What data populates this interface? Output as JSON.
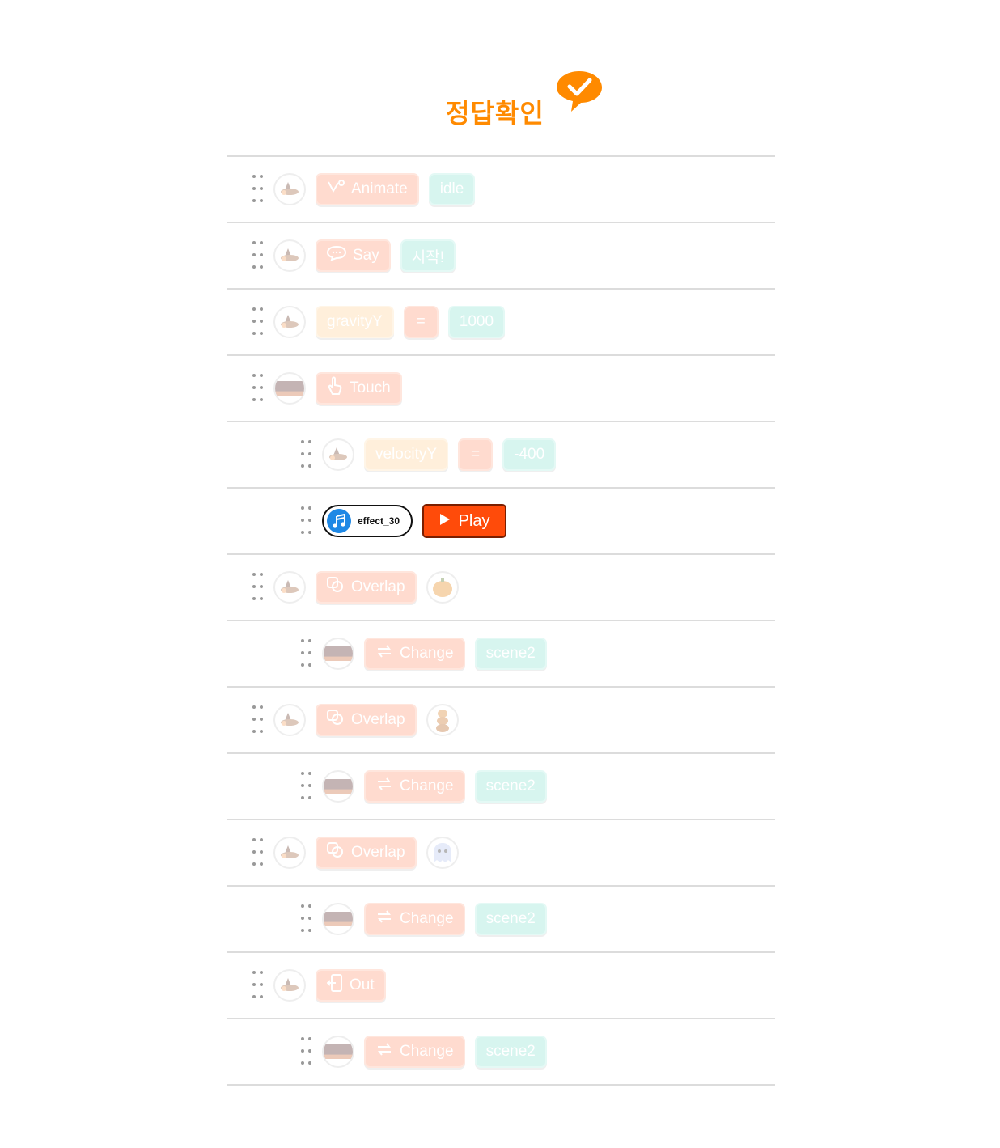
{
  "header": {
    "title": "정답확인",
    "check_icon": "check-bubble-icon",
    "accent": "#ff8a00"
  },
  "rows": [
    {
      "indent": 0,
      "avatar": "witch-sprite",
      "blocks": [
        {
          "kind": "action",
          "icon": "animate-icon",
          "label": "Animate"
        },
        {
          "kind": "value",
          "label": "idle"
        }
      ]
    },
    {
      "indent": 0,
      "avatar": "witch-sprite",
      "blocks": [
        {
          "kind": "action",
          "icon": "speech-bubble-icon",
          "label": "Say"
        },
        {
          "kind": "value",
          "label": "시작!"
        }
      ]
    },
    {
      "indent": 0,
      "avatar": "witch-sprite",
      "blocks": [
        {
          "kind": "property",
          "label": "gravityY"
        },
        {
          "kind": "operator",
          "label": "="
        },
        {
          "kind": "value",
          "label": "1000"
        }
      ]
    },
    {
      "indent": 0,
      "avatar": "background-sprite",
      "blocks": [
        {
          "kind": "action",
          "icon": "touch-icon",
          "label": "Touch"
        }
      ]
    },
    {
      "indent": 1,
      "avatar": "witch-sprite",
      "blocks": [
        {
          "kind": "property",
          "label": "velocityY"
        },
        {
          "kind": "operator",
          "label": "="
        },
        {
          "kind": "value",
          "label": "-400"
        }
      ]
    },
    {
      "indent": 1,
      "active": true,
      "sound": {
        "name": "effect_30",
        "icon": "music-note-icon"
      },
      "play": {
        "label": "Play",
        "icon": "play-icon",
        "color": "#ff4b0a"
      }
    },
    {
      "indent": 0,
      "avatar": "witch-sprite",
      "blocks": [
        {
          "kind": "action",
          "icon": "overlap-icon",
          "label": "Overlap"
        },
        {
          "kind": "target",
          "target": "pumpkin-sprite"
        }
      ]
    },
    {
      "indent": 1,
      "avatar": "background-sprite",
      "blocks": [
        {
          "kind": "action",
          "icon": "change-icon",
          "label": "Change"
        },
        {
          "kind": "value",
          "label": "scene2"
        }
      ]
    },
    {
      "indent": 0,
      "avatar": "witch-sprite",
      "blocks": [
        {
          "kind": "action",
          "icon": "overlap-icon",
          "label": "Overlap"
        },
        {
          "kind": "target",
          "target": "pumpkin-stack-sprite"
        }
      ]
    },
    {
      "indent": 1,
      "avatar": "background-sprite",
      "blocks": [
        {
          "kind": "action",
          "icon": "change-icon",
          "label": "Change"
        },
        {
          "kind": "value",
          "label": "scene2"
        }
      ]
    },
    {
      "indent": 0,
      "avatar": "witch-sprite",
      "blocks": [
        {
          "kind": "action",
          "icon": "overlap-icon",
          "label": "Overlap"
        },
        {
          "kind": "target",
          "target": "ghost-sprite"
        }
      ]
    },
    {
      "indent": 1,
      "avatar": "background-sprite",
      "blocks": [
        {
          "kind": "action",
          "icon": "change-icon",
          "label": "Change"
        },
        {
          "kind": "value",
          "label": "scene2"
        }
      ]
    },
    {
      "indent": 0,
      "avatar": "witch-sprite",
      "blocks": [
        {
          "kind": "action",
          "icon": "exit-icon",
          "label": "Out"
        }
      ]
    },
    {
      "indent": 1,
      "avatar": "background-sprite",
      "blocks": [
        {
          "kind": "action",
          "icon": "change-icon",
          "label": "Change"
        },
        {
          "kind": "value",
          "label": "scene2"
        }
      ]
    }
  ]
}
